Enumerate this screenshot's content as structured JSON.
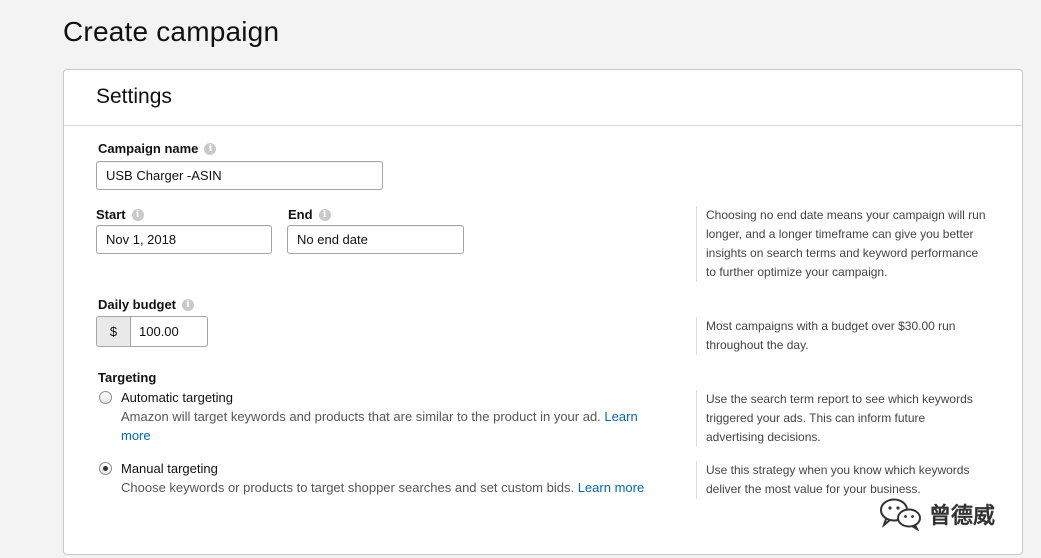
{
  "page": {
    "title": "Create campaign"
  },
  "settings": {
    "title": "Settings",
    "campaign_name": {
      "label": "Campaign name",
      "value": "USB Charger -ASIN"
    },
    "start": {
      "label": "Start",
      "value": "Nov 1, 2018"
    },
    "end": {
      "label": "End",
      "value": "No end date"
    },
    "end_help": "Choosing no end date means your campaign will run longer, and a longer timeframe can give you better insights on search terms and keyword performance to further optimize your campaign.",
    "daily_budget": {
      "label": "Daily budget",
      "currency": "$",
      "value": "100.00"
    },
    "budget_help": "Most campaigns with a budget over $30.00 run throughout the day.",
    "targeting": {
      "label": "Targeting",
      "automatic": {
        "title": "Automatic targeting",
        "desc": "Amazon will target keywords and products that are similar to the product in your ad.",
        "link": "Learn more",
        "help": "Use the search term report to see which keywords triggered your ads. This can inform future advertising decisions.",
        "selected": false
      },
      "manual": {
        "title": "Manual targeting",
        "desc": "Choose keywords or products to target shopper searches and set custom bids.",
        "link": "Learn more",
        "help": "Use this strategy when you know which keywords deliver the most value for your business.",
        "selected": true
      }
    }
  },
  "watermark": {
    "text": "曾德威",
    "icon": "wechat-icon"
  },
  "colors": {
    "link": "#0066c0",
    "background": "#f3f3f3",
    "panel_border": "#c8c8c8"
  }
}
